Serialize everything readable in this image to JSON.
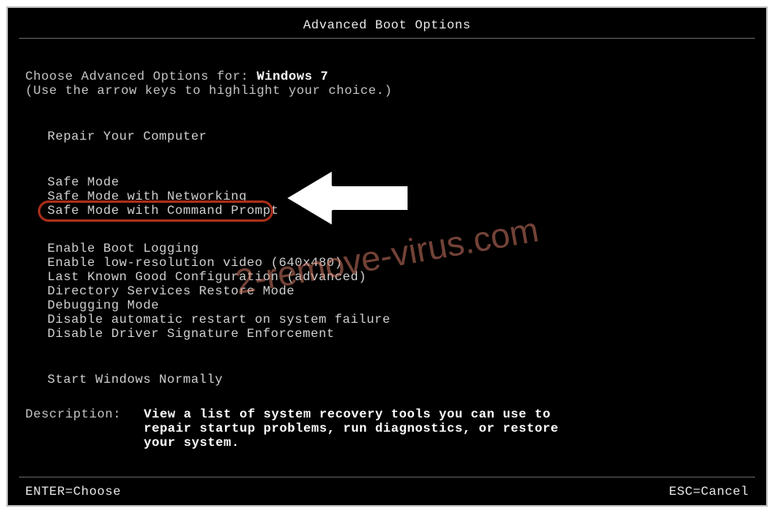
{
  "title": "Advanced Boot Options",
  "header": {
    "prefix": "Choose Advanced Options for: ",
    "os": "Windows 7",
    "hint": "(Use the arrow keys to highlight your choice.)"
  },
  "groups": {
    "repair": {
      "label": "Repair Your Computer"
    },
    "safe": [
      "Safe Mode",
      "Safe Mode with Networking",
      "Safe Mode with Command Prompt"
    ],
    "advanced": [
      "Enable Boot Logging",
      "Enable low-resolution video (640x480)",
      "Last Known Good Configuration (advanced)",
      "Directory Services Restore Mode",
      "Debugging Mode",
      "Disable automatic restart on system failure",
      "Disable Driver Signature Enforcement"
    ],
    "normal": {
      "label": "Start Windows Normally"
    }
  },
  "description": {
    "label": "Description:",
    "text": "View a list of system recovery tools you can use to repair startup problems, run diagnostics, or restore your system."
  },
  "footer": {
    "left": "ENTER=Choose",
    "right": "ESC=Cancel"
  },
  "annotation": {
    "highlighted_index": 2
  },
  "watermark": "2-remove-virus.com"
}
